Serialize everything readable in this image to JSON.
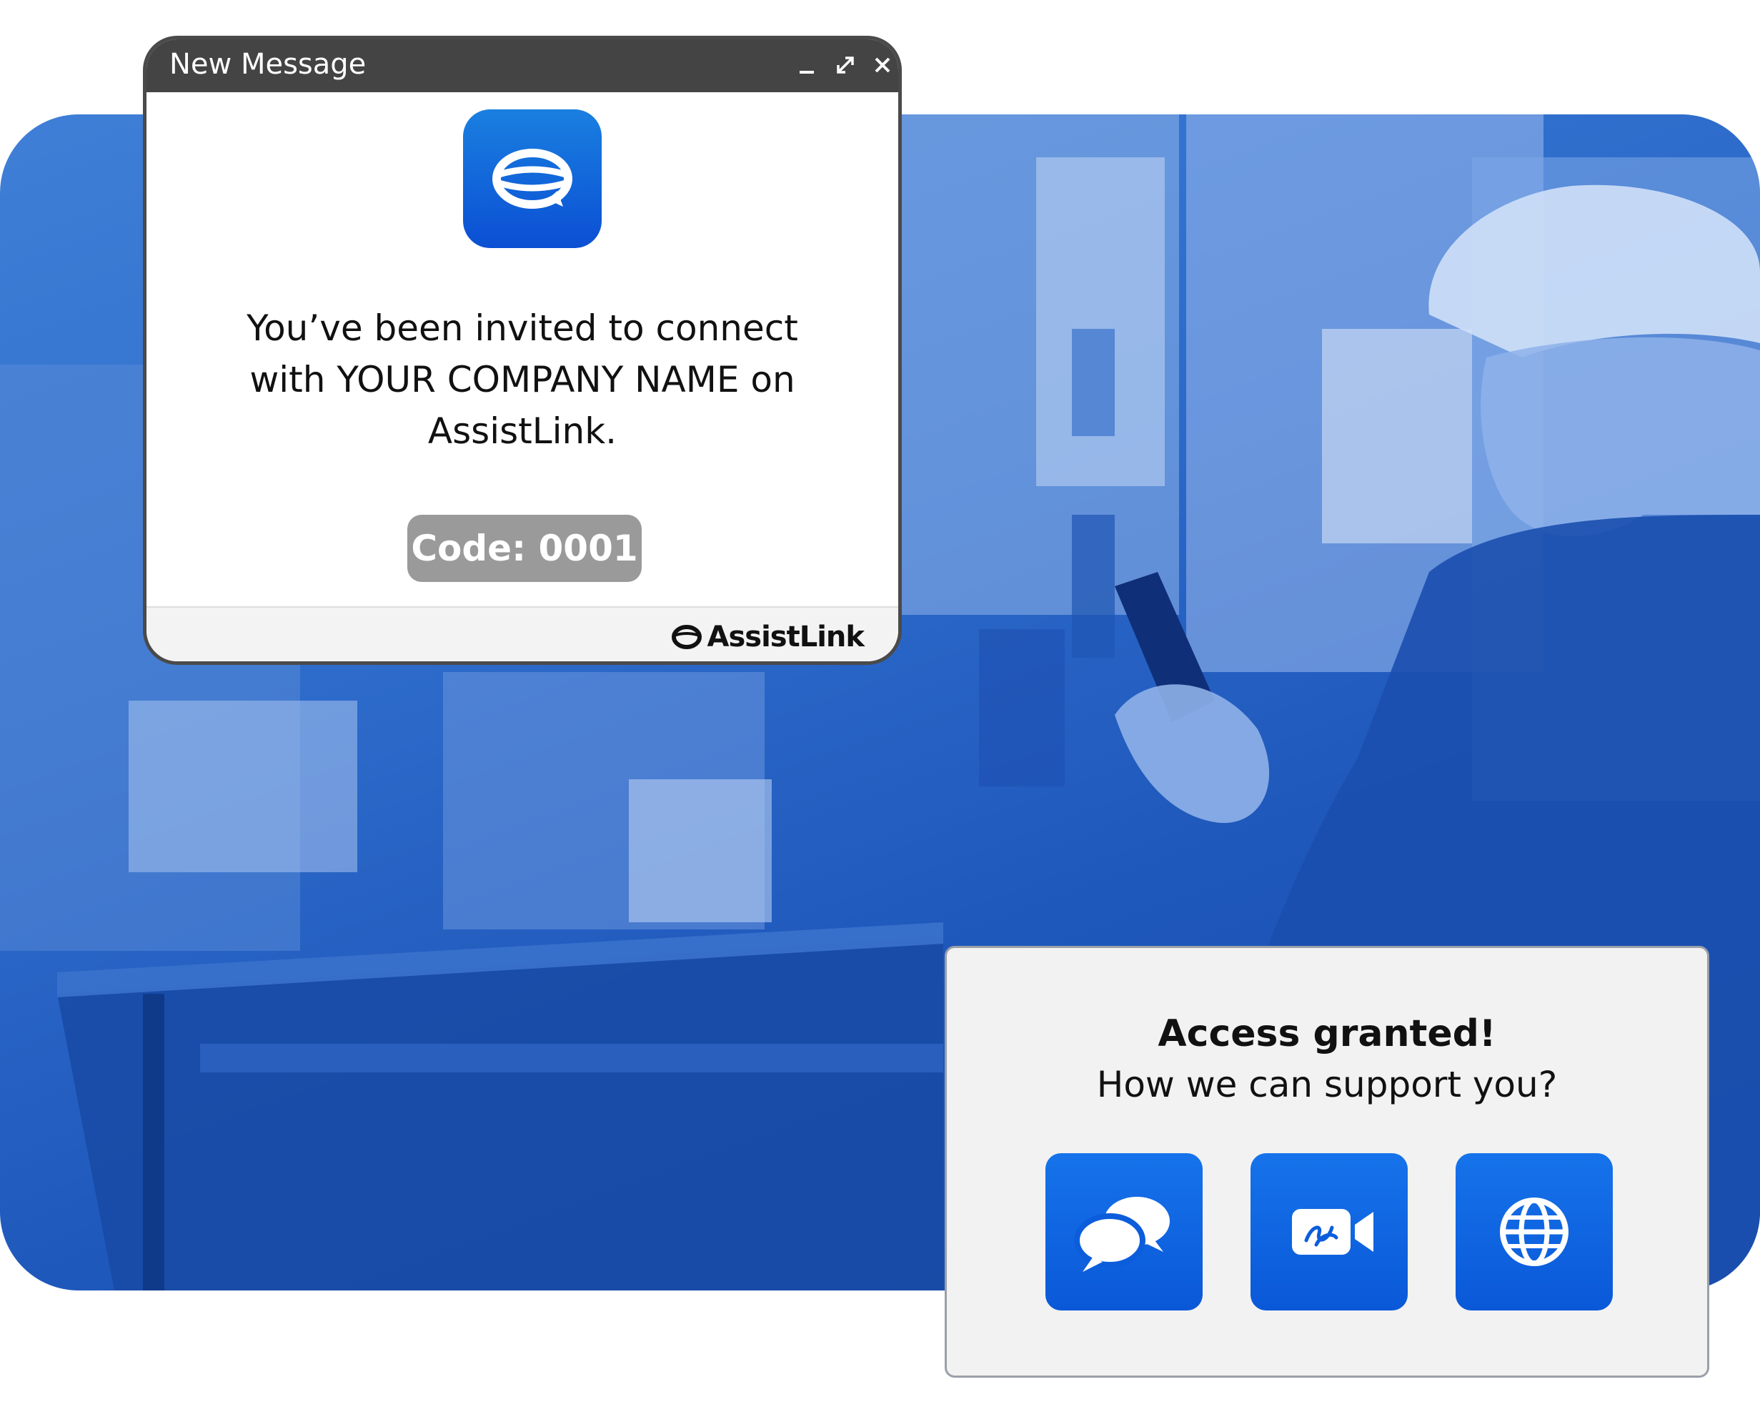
{
  "colors": {
    "brand_blue": "#0b5bd8",
    "titlebar": "#444444",
    "code_badge": "#9a9a9a",
    "panel_bg": "#f2f2f2"
  },
  "message_window": {
    "title": "New Message",
    "controls": {
      "minimize_icon": "minimize-icon",
      "maximize_icon": "maximize-icon",
      "close_icon": "close-icon"
    },
    "app_icon": "assistlink-chat-bubble-icon",
    "invite_line_1": "You’ve been invited to connect",
    "invite_line_2": "with YOUR COMPANY NAME on",
    "invite_line_3": "AssistLink.",
    "code_label": "Code: 0001",
    "footer_brand": "AssistLink"
  },
  "access_panel": {
    "title": "Access granted!",
    "subtitle": "How we can support you?",
    "buttons": [
      {
        "icon": "chat-bubbles-icon"
      },
      {
        "icon": "video-call-icon"
      },
      {
        "icon": "globe-icon"
      }
    ]
  }
}
